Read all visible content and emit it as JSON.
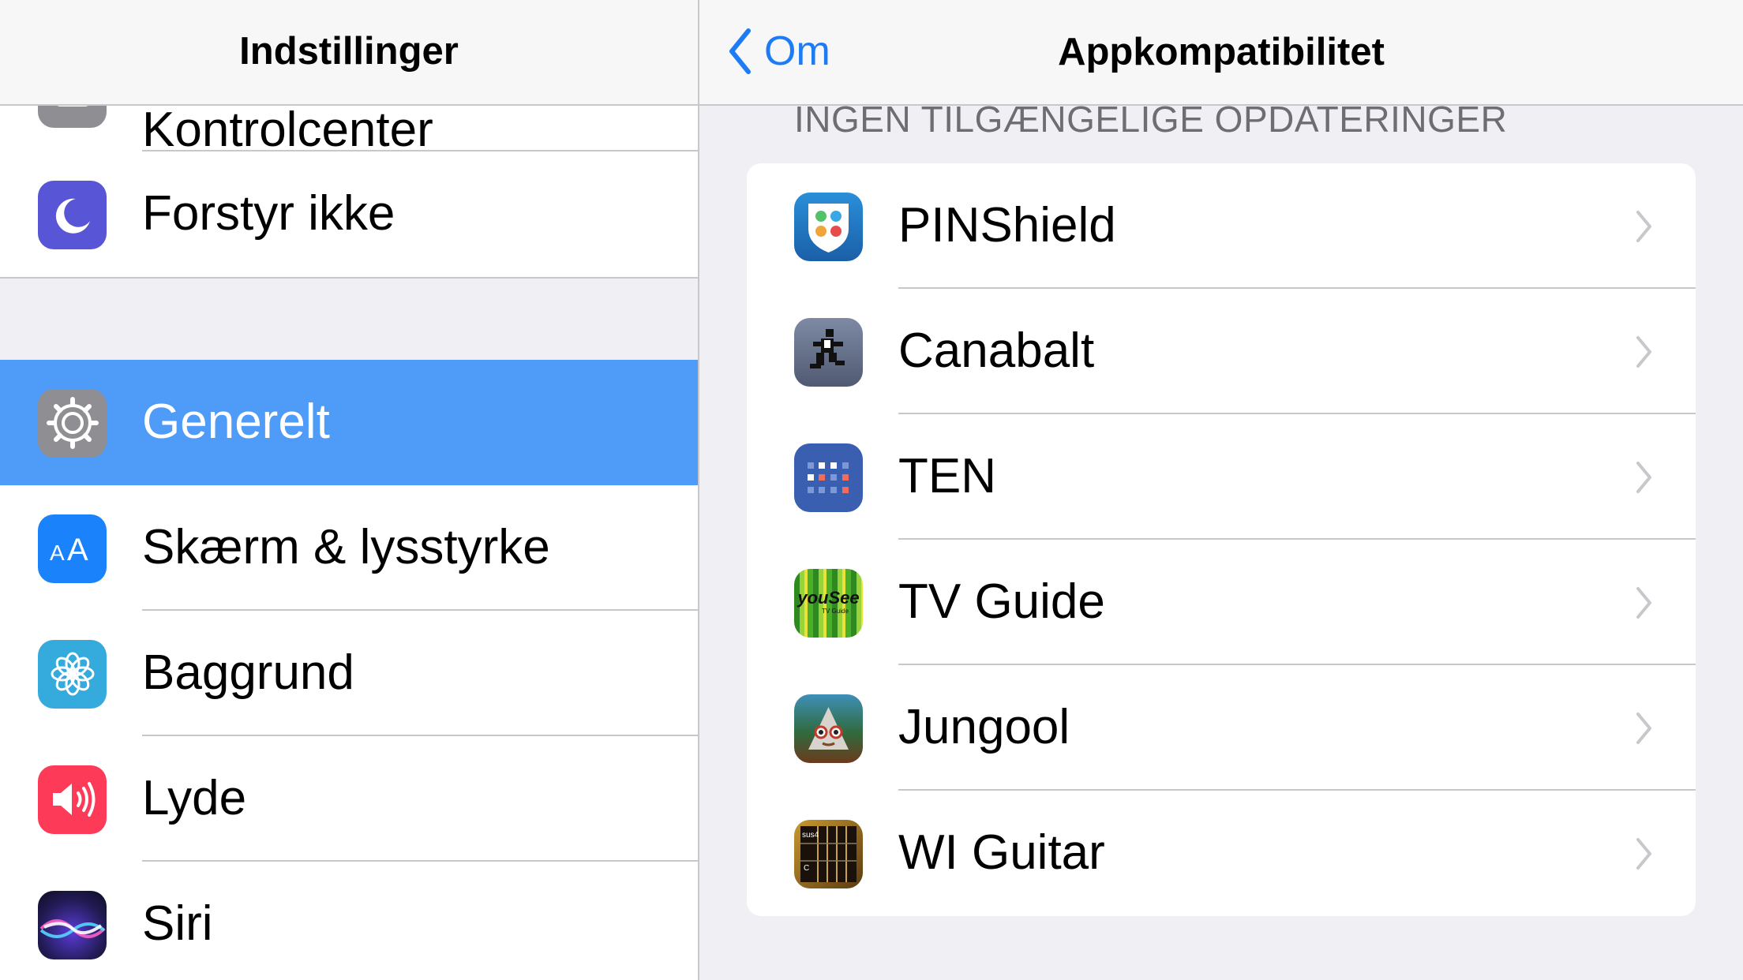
{
  "master": {
    "title": "Indstillinger",
    "partial_item": {
      "label": "Kontrolcenter",
      "icon": "switches-icon",
      "color": "#8e8e93"
    },
    "group1": [
      {
        "label": "Forstyr ikke",
        "icon": "moon-icon",
        "color": "#5856d6"
      }
    ],
    "group2": [
      {
        "label": "Generelt",
        "icon": "gear-icon",
        "color": "#8e8e93",
        "selected": true
      },
      {
        "label": "Skærm & lysstyrke",
        "icon": "text-size-icon",
        "color": "#1a82fb"
      },
      {
        "label": "Baggrund",
        "icon": "flower-icon",
        "color": "#35aadc"
      },
      {
        "label": "Lyde",
        "icon": "speaker-icon",
        "color": "#fd3b58"
      },
      {
        "label": "Siri",
        "icon": "siri-icon",
        "color": "#2b2b6a"
      }
    ]
  },
  "detail": {
    "back_label": "Om",
    "title": "Appkompatibilitet",
    "section_header": "INGEN TILGÆNGELIGE OPDATERINGER",
    "apps": [
      {
        "name": "PINShield",
        "icon": "pinshield-app-icon"
      },
      {
        "name": "Canabalt",
        "icon": "canabalt-app-icon"
      },
      {
        "name": "TEN",
        "icon": "ten-app-icon"
      },
      {
        "name": "TV Guide",
        "icon": "tv-guide-app-icon",
        "icon_text": "youSee",
        "icon_subtext": "TV Guide"
      },
      {
        "name": "Jungool",
        "icon": "jungool-app-icon"
      },
      {
        "name": "WI Guitar",
        "icon": "wi-guitar-app-icon",
        "icon_text": "sus4",
        "icon_subtext": "C"
      }
    ]
  },
  "colors": {
    "accent": "#1d7bf6",
    "selection": "#4e9bf8",
    "separator": "#c8c7cc",
    "background": "#efeff4"
  }
}
